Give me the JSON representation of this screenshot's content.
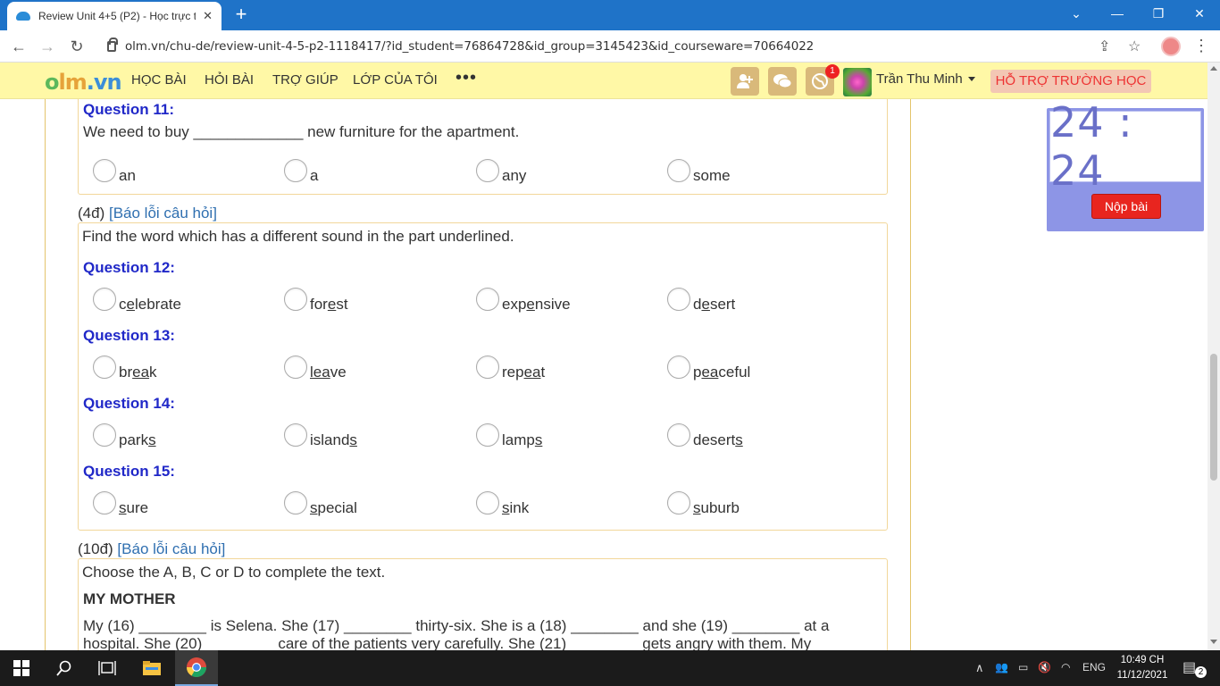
{
  "browser": {
    "tab_title": "Review Unit 4+5 (P2) - Học trực t",
    "url": "olm.vn/chu-de/review-unit-4-5-p2-1118417/?id_student=76864728&id_group=3145423&id_courseware=70664022"
  },
  "site": {
    "logo_part1": "o",
    "logo_part2": "lm",
    "logo_part3": ".vn",
    "menu": [
      "HỌC BÀI",
      "HỎI BÀI",
      "TRỢ GIÚP",
      "LỚP CỦA TÔI"
    ],
    "more": "•••",
    "notification_count": "1",
    "username": "Trần Thu Minh",
    "support_label": "HỖ TRỢ TRƯỜNG HỌC"
  },
  "q11": {
    "title": "Question 11:",
    "text": "We need to buy _____________ new furniture for the apartment.",
    "options": [
      "an",
      "a",
      "any",
      "some"
    ]
  },
  "section2": {
    "points": "(4đ)",
    "report": "[Báo lỗi câu hỏi]",
    "instruction": "Find the word which has a different sound in the part underlined."
  },
  "q12": {
    "title": "Question 12:",
    "options": [
      [
        "c",
        "e",
        "lebrate"
      ],
      [
        "for",
        "e",
        "st"
      ],
      [
        "exp",
        "e",
        "nsive"
      ],
      [
        "d",
        "e",
        "sert"
      ]
    ]
  },
  "q13": {
    "title": "Question 13:",
    "options": [
      [
        "br",
        "ea",
        "k"
      ],
      [
        "",
        "lea",
        "ve"
      ],
      [
        "rep",
        "ea",
        "t"
      ],
      [
        "p",
        "ea",
        "ceful"
      ]
    ]
  },
  "q14": {
    "title": "Question 14:",
    "options": [
      [
        "park",
        "s",
        ""
      ],
      [
        "island",
        "s",
        ""
      ],
      [
        "lamp",
        "s",
        ""
      ],
      [
        "desert",
        "s",
        ""
      ]
    ]
  },
  "q15": {
    "title": "Question 15:",
    "options": [
      [
        "",
        "s",
        "ure"
      ],
      [
        "",
        "s",
        "pecial"
      ],
      [
        "",
        "s",
        "ink"
      ],
      [
        "",
        "s",
        "uburb"
      ]
    ]
  },
  "section3": {
    "points": "(10đ)",
    "report": "[Báo lỗi câu hỏi]",
    "instruction": "Choose the A, B, C or D to complete the text.",
    "passage_title": "MY MOTHER",
    "line1": "My (16) ________ is Selena. She (17) ________ thirty-six. She is a (18) ________ and she (19) ________ at a",
    "line2": "hospital. She (20) ________ care of the patients very carefully. She (21) ________ gets angry with them. My"
  },
  "timer": {
    "display": "24 : 24",
    "submit_label": "Nộp bài"
  },
  "taskbar": {
    "language": "ENG",
    "time": "10:49 CH",
    "date": "11/12/2021",
    "notifications": "2"
  }
}
